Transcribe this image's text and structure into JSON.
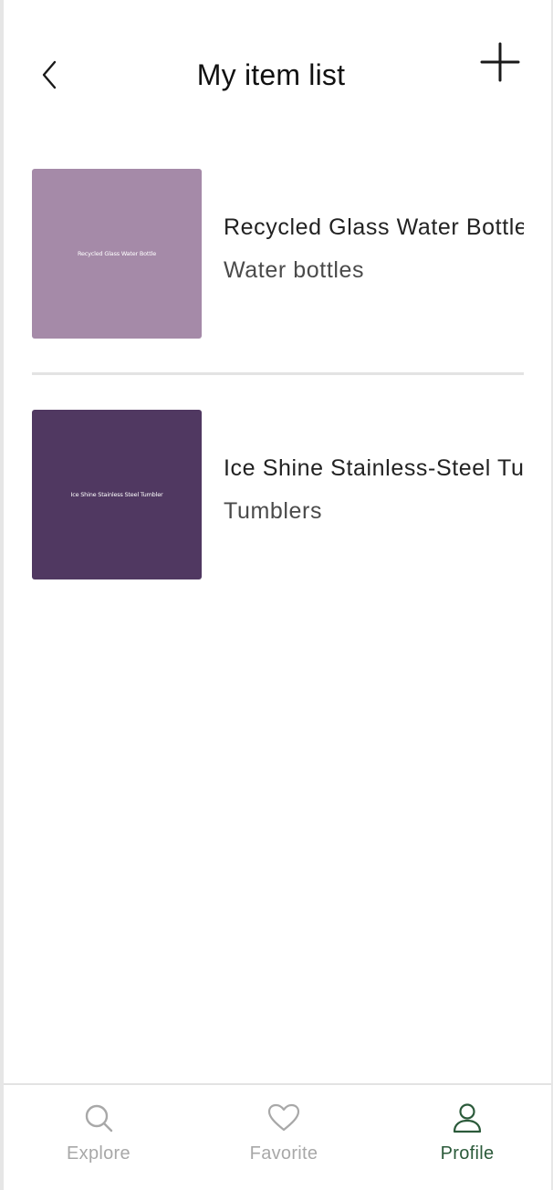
{
  "header": {
    "title": "My item list",
    "back_icon": "chevron-left-icon",
    "add_icon": "plus-icon"
  },
  "items": [
    {
      "title": "Recycled Glass Water Bottle",
      "category": "Water bottles",
      "thumbnail_text": "Recycled Glass Water Bottle",
      "thumbnail_color": "#a58aa8"
    },
    {
      "title": "Ice Shine Stainless-Steel Tumbler",
      "category": "Tumblers",
      "thumbnail_text": "Ice Shine Stainless Steel Tumbler",
      "thumbnail_color": "#503861"
    }
  ],
  "bottom_nav": {
    "explore": {
      "label": "Explore",
      "icon": "search-icon"
    },
    "favorite": {
      "label": "Favorite",
      "icon": "heart-icon"
    },
    "profile": {
      "label": "Profile",
      "icon": "user-icon"
    },
    "active_color": "#2b5a3a",
    "inactive_color": "#a8a8a8"
  }
}
